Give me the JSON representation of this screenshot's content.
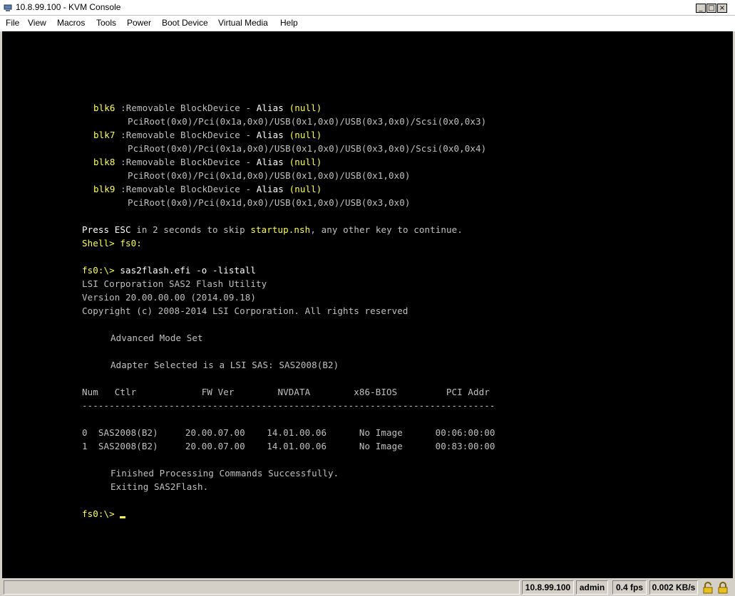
{
  "window": {
    "title": "10.8.99.100 - KVM Console",
    "controls": {
      "minimize": "_",
      "maximize": "□",
      "close": "×"
    }
  },
  "menu": {
    "file": "File",
    "view": "View",
    "macros": "Macros",
    "tools": "Tools",
    "power": "Power",
    "boot_device": "Boot Device",
    "virtual_media": "Virtual Media",
    "help": "Help"
  },
  "console": {
    "lines": [
      {
        "id": "blk6",
        "parts": [
          {
            "t": "blk6 ",
            "c": "y"
          },
          {
            "t": ":Removable BlockDevice - ",
            "c": "g"
          },
          {
            "t": "Alias ",
            "c": "w"
          },
          {
            "t": "(null)",
            "c": "y"
          }
        ]
      },
      {
        "id": "blk6-path",
        "parts": [
          {
            "t": "PciRoot(0x0)/Pci(0x1a,0x0)/USB(0x1,0x0)/USB(0x3,0x0)/Scsi(0x0,0x3)",
            "c": "g"
          }
        ]
      },
      {
        "id": "blk7",
        "parts": [
          {
            "t": "blk7 ",
            "c": "y"
          },
          {
            "t": ":Removable BlockDevice - ",
            "c": "g"
          },
          {
            "t": "Alias ",
            "c": "w"
          },
          {
            "t": "(null)",
            "c": "y"
          }
        ]
      },
      {
        "id": "blk7-path",
        "parts": [
          {
            "t": "PciRoot(0x0)/Pci(0x1a,0x0)/USB(0x1,0x0)/USB(0x3,0x0)/Scsi(0x0,0x4)",
            "c": "g"
          }
        ]
      },
      {
        "id": "blk8",
        "parts": [
          {
            "t": "blk8 ",
            "c": "y"
          },
          {
            "t": ":Removable BlockDevice - ",
            "c": "g"
          },
          {
            "t": "Alias ",
            "c": "w"
          },
          {
            "t": "(null)",
            "c": "y"
          }
        ]
      },
      {
        "id": "blk8-path",
        "parts": [
          {
            "t": "PciRoot(0x0)/Pci(0x1d,0x0)/USB(0x1,0x0)/USB(0x1,0x0)",
            "c": "g"
          }
        ]
      },
      {
        "id": "blk9",
        "parts": [
          {
            "t": "blk9 ",
            "c": "y"
          },
          {
            "t": ":Removable BlockDevice - ",
            "c": "g"
          },
          {
            "t": "Alias ",
            "c": "w"
          },
          {
            "t": "(null)",
            "c": "y"
          }
        ]
      },
      {
        "id": "blk9-path",
        "parts": [
          {
            "t": "PciRoot(0x0)/Pci(0x1d,0x0)/USB(0x1,0x0)/USB(0x3,0x0)",
            "c": "g"
          }
        ]
      },
      {
        "id": "press-esc",
        "parts": [
          {
            "t": "Press ",
            "c": "w"
          },
          {
            "t": "ESC",
            "c": "w"
          },
          {
            "t": " in 2 seconds to skip ",
            "c": "g"
          },
          {
            "t": "startup.nsh",
            "c": "y"
          },
          {
            "t": ", any other key to continue.",
            "c": "g"
          }
        ]
      },
      {
        "id": "shell-prompt",
        "parts": [
          {
            "t": "Shell> fs0:",
            "c": "y"
          }
        ]
      },
      {
        "id": "fs0-command",
        "parts": [
          {
            "t": "fs0:\\> ",
            "c": "y"
          },
          {
            "t": "sas2flash.efi -o -listall",
            "c": "w"
          }
        ]
      },
      {
        "id": "lsi-utility",
        "parts": [
          {
            "t": "LSI Corporation SAS2 Flash Utility",
            "c": "g"
          }
        ]
      },
      {
        "id": "version",
        "parts": [
          {
            "t": "Version 20.00.00.00 (2014.09.18)",
            "c": "g"
          }
        ]
      },
      {
        "id": "copyright",
        "parts": [
          {
            "t": "Copyright (c) 2008-2014 LSI Corporation. All rights reserved",
            "c": "g"
          }
        ]
      },
      {
        "id": "advanced-mode",
        "parts": [
          {
            "t": "Advanced Mode Set",
            "c": "g"
          }
        ]
      },
      {
        "id": "adapter-selected",
        "parts": [
          {
            "t": "Adapter Selected is a LSI SAS: SAS2008(B2)",
            "c": "g"
          }
        ]
      },
      {
        "id": "table-header",
        "parts": [
          {
            "t": "Num   Ctlr            FW Ver        NVDATA        x86-BIOS         PCI Addr",
            "c": "g"
          }
        ]
      },
      {
        "id": "table-divider",
        "parts": [
          {
            "t": "----------------------------------------------------------------------------",
            "c": "g"
          }
        ]
      },
      {
        "id": "row-0",
        "parts": [
          {
            "t": "0  SAS2008(B2)     20.00.07.00    14.01.00.06      No Image      00:06:00:00",
            "c": "g"
          }
        ]
      },
      {
        "id": "row-1",
        "parts": [
          {
            "t": "1  SAS2008(B2)     20.00.07.00    14.01.00.06      No Image      00:83:00:00",
            "c": "g"
          }
        ]
      },
      {
        "id": "finished",
        "parts": [
          {
            "t": "Finished Processing Commands Successfully.",
            "c": "g"
          }
        ]
      },
      {
        "id": "exiting",
        "parts": [
          {
            "t": "Exiting SAS2Flash.",
            "c": "g"
          }
        ]
      },
      {
        "id": "final-prompt",
        "parts": [
          {
            "t": "fs0:\\> ",
            "c": "y"
          }
        ]
      }
    ]
  },
  "status": {
    "ip": "10.8.99.100",
    "user": "admin",
    "fps": "0.4 fps",
    "bandwidth": "0.002 KB/s"
  }
}
